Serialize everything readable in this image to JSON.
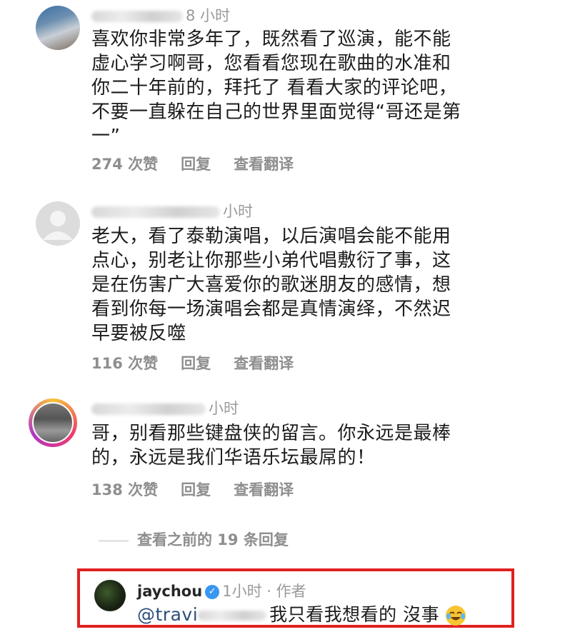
{
  "comments": [
    {
      "time": "8 小时",
      "text": "喜欢你非常多年了，既然看了巡演，能不能\n虚心学习啊哥，您看看您现在歌曲的水准和\n你二十年前的，拜托了 看看大家的评论吧，\n不要一直躲在自己的世界里面觉得“哥还是第\n一”",
      "likes": "274 次赞",
      "reply": "回复",
      "translate": "查看翻译"
    },
    {
      "time": "小时",
      "text": "老大，看了泰勒演唱，以后演唱会能不能用\n点心，别老让你那些小弟代唱敷衍了事，这\n是在伤害广大喜爱你的歌迷朋友的感情，想\n看到你每一场演唱会都是真情演绎，不然迟\n早要被反噬",
      "likes": "116 次赞",
      "reply": "回复",
      "translate": "查看翻译"
    },
    {
      "time": "小时",
      "text": "哥，别看那些键盘侠的留言。你永远是最棒\n的，永远是我们华语乐坛最屌的！",
      "likes": "138 次赞",
      "reply": "回复",
      "translate": "查看翻译"
    }
  ],
  "view_replies": "查看之前的 19 条回复",
  "reply": {
    "username": "jaychou",
    "time": "1小时 · 作者",
    "mention": "@travi",
    "text": "我只看我想看的 沒事",
    "emoji": "face-with-tears-of-joy"
  },
  "colors": {
    "highlight_border": "#e02020",
    "verified": "#3897f0",
    "meta_gray": "#9a9a9a"
  }
}
